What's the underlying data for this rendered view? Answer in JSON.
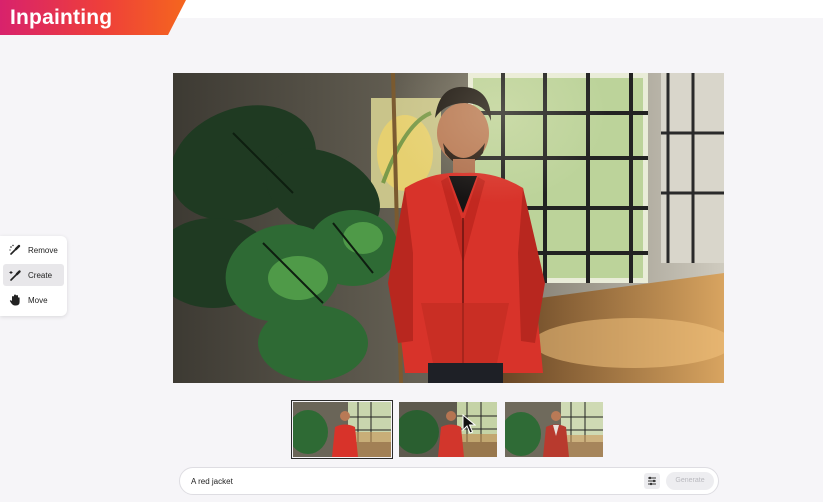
{
  "banner": {
    "title": "Inpainting"
  },
  "tools": [
    {
      "label": "Remove",
      "icon": "remove-brush-icon",
      "active": false
    },
    {
      "label": "Create",
      "icon": "create-brush-icon",
      "active": true
    },
    {
      "label": "Move",
      "icon": "hand-icon",
      "active": false
    }
  ],
  "thumbnails": [
    {
      "selected": true,
      "jacket_color": "#d8332a"
    },
    {
      "selected": false,
      "jacket_color": "#d2362c"
    },
    {
      "selected": false,
      "jacket_color": "#b83a2e"
    }
  ],
  "prompt": {
    "value": "A red jacket"
  },
  "generate": {
    "label": "Generate"
  },
  "colors": {
    "banner_start": "#d8226c",
    "banner_end": "#f5661e",
    "jacket": "#d8332a"
  }
}
